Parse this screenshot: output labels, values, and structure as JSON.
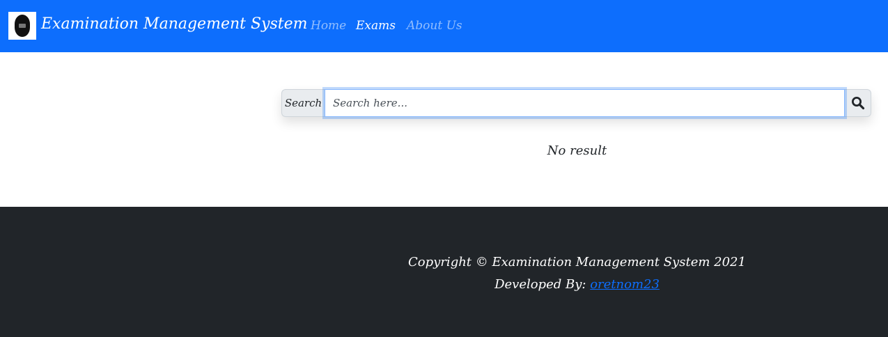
{
  "header": {
    "title": "Examination Management System",
    "logo_icon": "school-seal-logo",
    "nav": [
      {
        "label": "Home",
        "active": false
      },
      {
        "label": "Exams",
        "active": true
      },
      {
        "label": "About Us",
        "active": false
      }
    ]
  },
  "search": {
    "label": "Search",
    "placeholder": "Search here...",
    "value": "",
    "button_icon": "search-icon"
  },
  "results": {
    "message": "No result"
  },
  "footer": {
    "copyright": "Copyright © Examination Management System 2021",
    "developed_by_label": "Developed By:",
    "developer_link": "oretnom23"
  },
  "colors": {
    "navbar": "#0d6efd",
    "footer": "#212529",
    "link": "#0d6efd"
  }
}
